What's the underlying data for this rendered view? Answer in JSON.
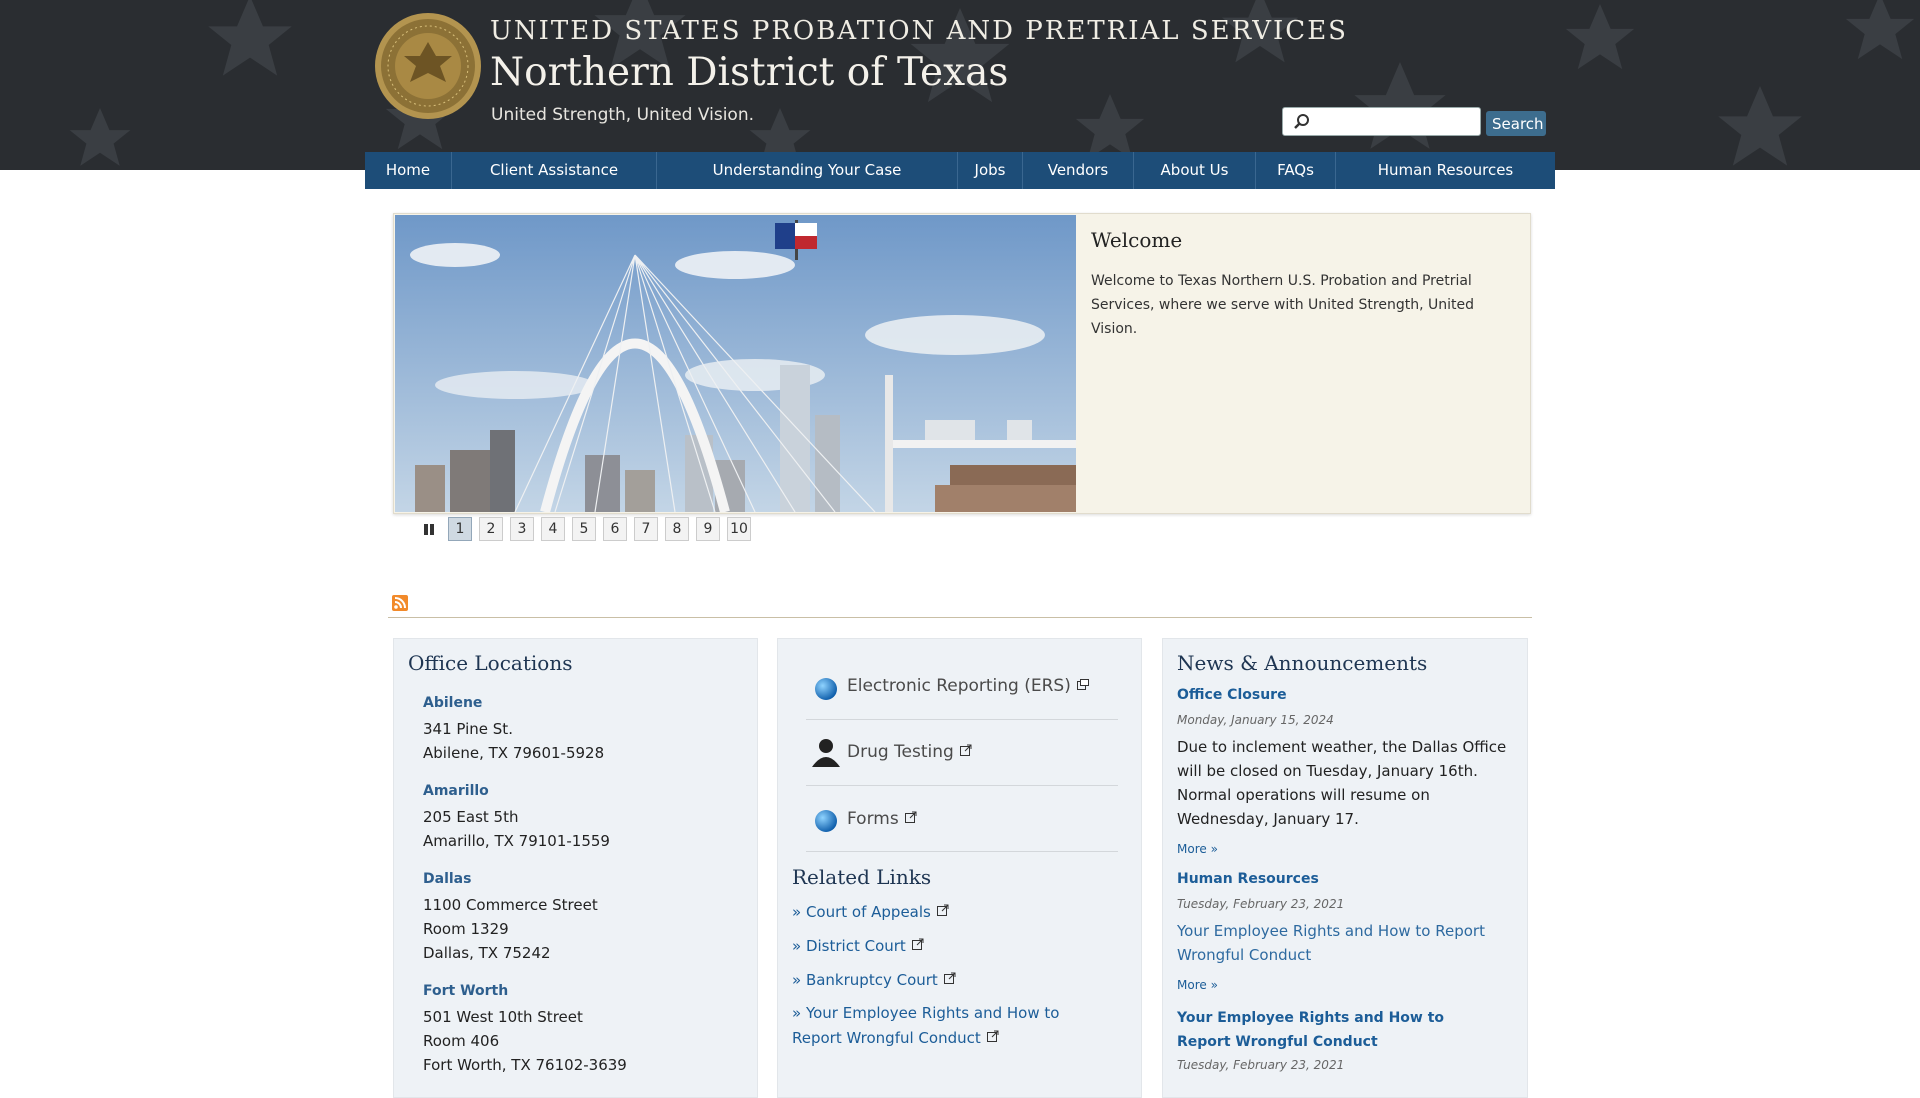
{
  "header": {
    "agency": "UNITED STATES PROBATION AND PRETRIAL SERVICES",
    "district": "Northern District of Texas",
    "motto": "United Strength, United Vision.",
    "search_placeholder": "",
    "search_button": "Search",
    "search_icon": "magnifier-icon",
    "seal_icon": "us-courts-seal-icon"
  },
  "nav": {
    "items": [
      "Home",
      "Client Assistance",
      "Understanding Your Case",
      "Jobs",
      "Vendors",
      "About Us",
      "FAQs",
      "Human Resources"
    ]
  },
  "slider": {
    "title": "Welcome",
    "text": "Welcome to Texas Northern U.S. Probation and Pretrial Services, where we serve with United Strength, United Vision.",
    "pages": [
      "1",
      "2",
      "3",
      "4",
      "5",
      "6",
      "7",
      "8",
      "9",
      "10"
    ],
    "active_page": "1",
    "pause_icon": "pause-icon"
  },
  "rss_icon": "rss-icon",
  "offices": {
    "title": "Office Locations",
    "locations": [
      {
        "city": "Abilene",
        "lines": [
          "341 Pine St.",
          "Abilene, TX 79601-5928"
        ]
      },
      {
        "city": "Amarillo",
        "lines": [
          "205 East 5th",
          "Amarillo, TX 79101-1559"
        ]
      },
      {
        "city": "Dallas",
        "lines": [
          "1100 Commerce Street",
          "Room 1329",
          "Dallas, TX 75242"
        ]
      },
      {
        "city": "Fort Worth",
        "lines": [
          "501 West 10th Street",
          "Room 406",
          "Fort Worth, TX 76102-3639"
        ]
      }
    ]
  },
  "quicklinks": {
    "items": [
      {
        "label": "Electronic Reporting (ERS)",
        "icon": "globe-icon"
      },
      {
        "label": "Drug Testing",
        "icon": "person-silhouette-icon"
      },
      {
        "label": "Forms",
        "icon": "globe-icon"
      }
    ],
    "related_title": "Related Links",
    "related": [
      "» Court of Appeals",
      "» District Court",
      "» Bankruptcy Court",
      "» Your Employee Rights and How to Report Wrongful Conduct"
    ]
  },
  "news": {
    "title": "News & Announcements",
    "items": [
      {
        "headline": "Office Closure",
        "date": "Monday, January 15, 2024",
        "body": "Due to inclement weather, the Dallas Office will be closed on Tuesday, January 16th. Normal operations will resume on Wednesday, January 17.",
        "more": "More »"
      },
      {
        "headline": "Human Resources",
        "date": "Tuesday, February 23, 2021",
        "body": "Your Employee Rights and How to Report Wrongful Conduct",
        "more": "More »"
      },
      {
        "headline": "Your Employee Rights and How to Report Wrongful Conduct",
        "date": "Tuesday, February 23, 2021"
      }
    ]
  },
  "colors": {
    "header_bg": "#2a2d31",
    "nav_bg": "#1d4d78",
    "link": "#1c5d98",
    "panel_bg": "#eef2f6",
    "welcome_bg": "#f6f3e8"
  }
}
